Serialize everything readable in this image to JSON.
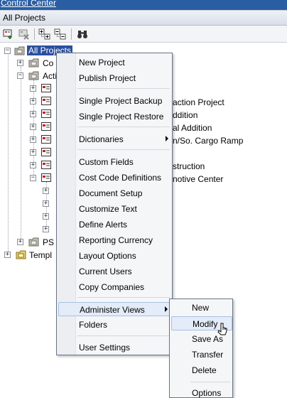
{
  "topbar": {
    "link": "Control Center"
  },
  "panel": {
    "title": "All Projects"
  },
  "toolbar": {
    "icons": [
      "new-project-icon",
      "delete-project-icon",
      "expand-all-icon",
      "collapse-all-icon",
      "binoculars-icon"
    ]
  },
  "tree": {
    "root_label": "All Projects",
    "nodes": {
      "con": "Co",
      "act": "Acti",
      "ps": "PS",
      "templ": "Templ"
    },
    "partial_labels": [
      "action Project",
      "ddition",
      "al Addition",
      "n/So. Cargo Ramp",
      "struction",
      "notive Center"
    ]
  },
  "context_menu": {
    "items": [
      "New Project",
      "Publish Project",
      "Single Project Backup",
      "Single Project Restore",
      "Dictionaries",
      "Custom Fields",
      "Cost Code Definitions",
      "Document Setup",
      "Customize Text",
      "Define Alerts",
      "Reporting Currency",
      "Layout Options",
      "Current Users",
      "Copy Companies",
      "Administer Views",
      "Folders",
      "User Settings"
    ]
  },
  "submenu": {
    "items": [
      "New",
      "Modify",
      "Save As",
      "Transfer",
      "Delete",
      "Options"
    ]
  },
  "colors": {
    "selection": "#2a4f9e",
    "menu_highlight": "#e3ecf8",
    "topbar": "#2a5ea3"
  }
}
